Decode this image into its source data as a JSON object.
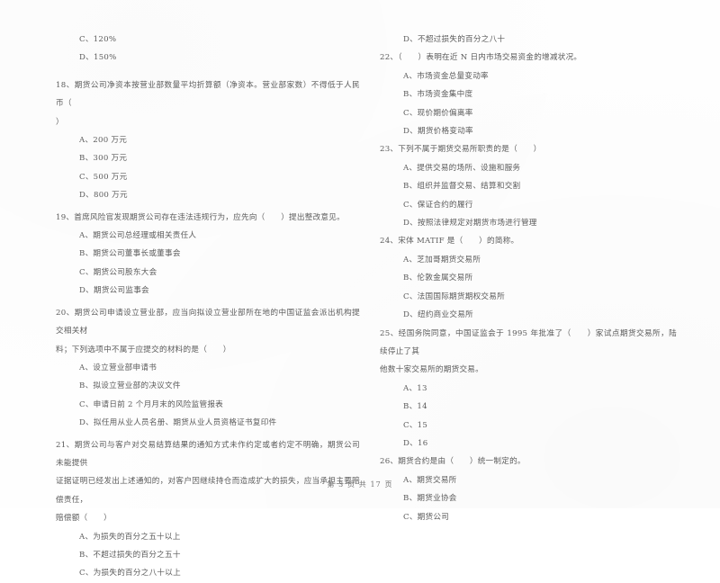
{
  "document": {
    "type": "scanned-exam-paper",
    "language": "zh-CN",
    "footer": "第 3 页 共 17 页"
  },
  "left_column": {
    "carryover_options": [
      "C、120%",
      "D、150%"
    ],
    "questions": [
      {
        "number": "18",
        "stem": "18、期货公司净资本按营业部数量平均折算额（净资本。营业部家数）不得低于人民币（",
        "stem_cont": "）",
        "options": [
          "A、200 万元",
          "B、300 万元",
          "C、500 万元",
          "D、800 万元"
        ]
      },
      {
        "number": "19",
        "stem": "19、首席风险官发现期货公司存在违法违规行为，应先向（　　）提出整改意见。",
        "stem_cont": "",
        "options": [
          "A、期货公司总经理或相关责任人",
          "B、期货公司董事长或董事会",
          "C、期货公司股东大会",
          "D、期货公司监事会"
        ]
      },
      {
        "number": "20",
        "stem": "20、期货公司申请设立营业部，应当向拟设立营业部所在地的中国证监会派出机构提交相关材",
        "stem_cont": "料；下列选项中不属于应提交的材料的是（　　）",
        "options": [
          "A、设立营业部申请书",
          "B、拟设立营业部的决议文件",
          "C、申请日前 2 个月月末的风险监管报表",
          "D、拟任用从业人员名册、期货从业人员资格证书复印件"
        ]
      },
      {
        "number": "21",
        "stem": "21、期货公司与客户对交易结算结果的通知方式未作约定或者约定不明确，期货公司未能提供",
        "stem_cont": "证据证明已经发出上述通知的，对客户因继续持仓而造成扩大的损失，应当承担主要赔偿责任，",
        "stem_cont2": "赔偿额（　　）",
        "options": [
          "A、为损失的百分之五十以上",
          "B、不超过损失的百分之五十",
          "C、为损失的百分之八十以上"
        ]
      }
    ]
  },
  "right_column": {
    "carryover_options": [
      "D、不超过损失的百分之八十"
    ],
    "questions": [
      {
        "number": "22",
        "stem": "22、（　　）表明在近 N 日内市场交易资金的增减状况。",
        "stem_cont": "",
        "options": [
          "A、市场资金总量变动率",
          "B、市场资金集中度",
          "C、现价期价偏离率",
          "D、期货价格变动率"
        ]
      },
      {
        "number": "23",
        "stem": "23、下列不属于期货交易所职责的是（　　）",
        "stem_cont": "",
        "options": [
          "A、提供交易的场所、设施和服务",
          "B、组织并监督交易、结算和交割",
          "C、保证合约的履行",
          "D、按照法律规定对期货市场进行管理"
        ]
      },
      {
        "number": "24",
        "stem": "24、宋体 MATIF 是（　　）的简称。",
        "stem_cont": "",
        "options": [
          "A、芝加哥期货交易所",
          "B、伦敦金属交易所",
          "C、法国国际期货期权交易所",
          "D、纽约商业交易所"
        ]
      },
      {
        "number": "25",
        "stem": "25、经国务院同意，中国证监会于 1995 年批准了（　　）家试点期货交易所，陆续停止了其",
        "stem_cont": "他数十家交易所的期货交易。",
        "options": [
          "A、13",
          "B、14",
          "C、15",
          "D、16"
        ]
      },
      {
        "number": "26",
        "stem": "26、期货合约是由（　　）统一制定的。",
        "stem_cont": "",
        "options": [
          "A、期货交易所",
          "B、期货业协会",
          "C、期货公司"
        ]
      }
    ]
  }
}
